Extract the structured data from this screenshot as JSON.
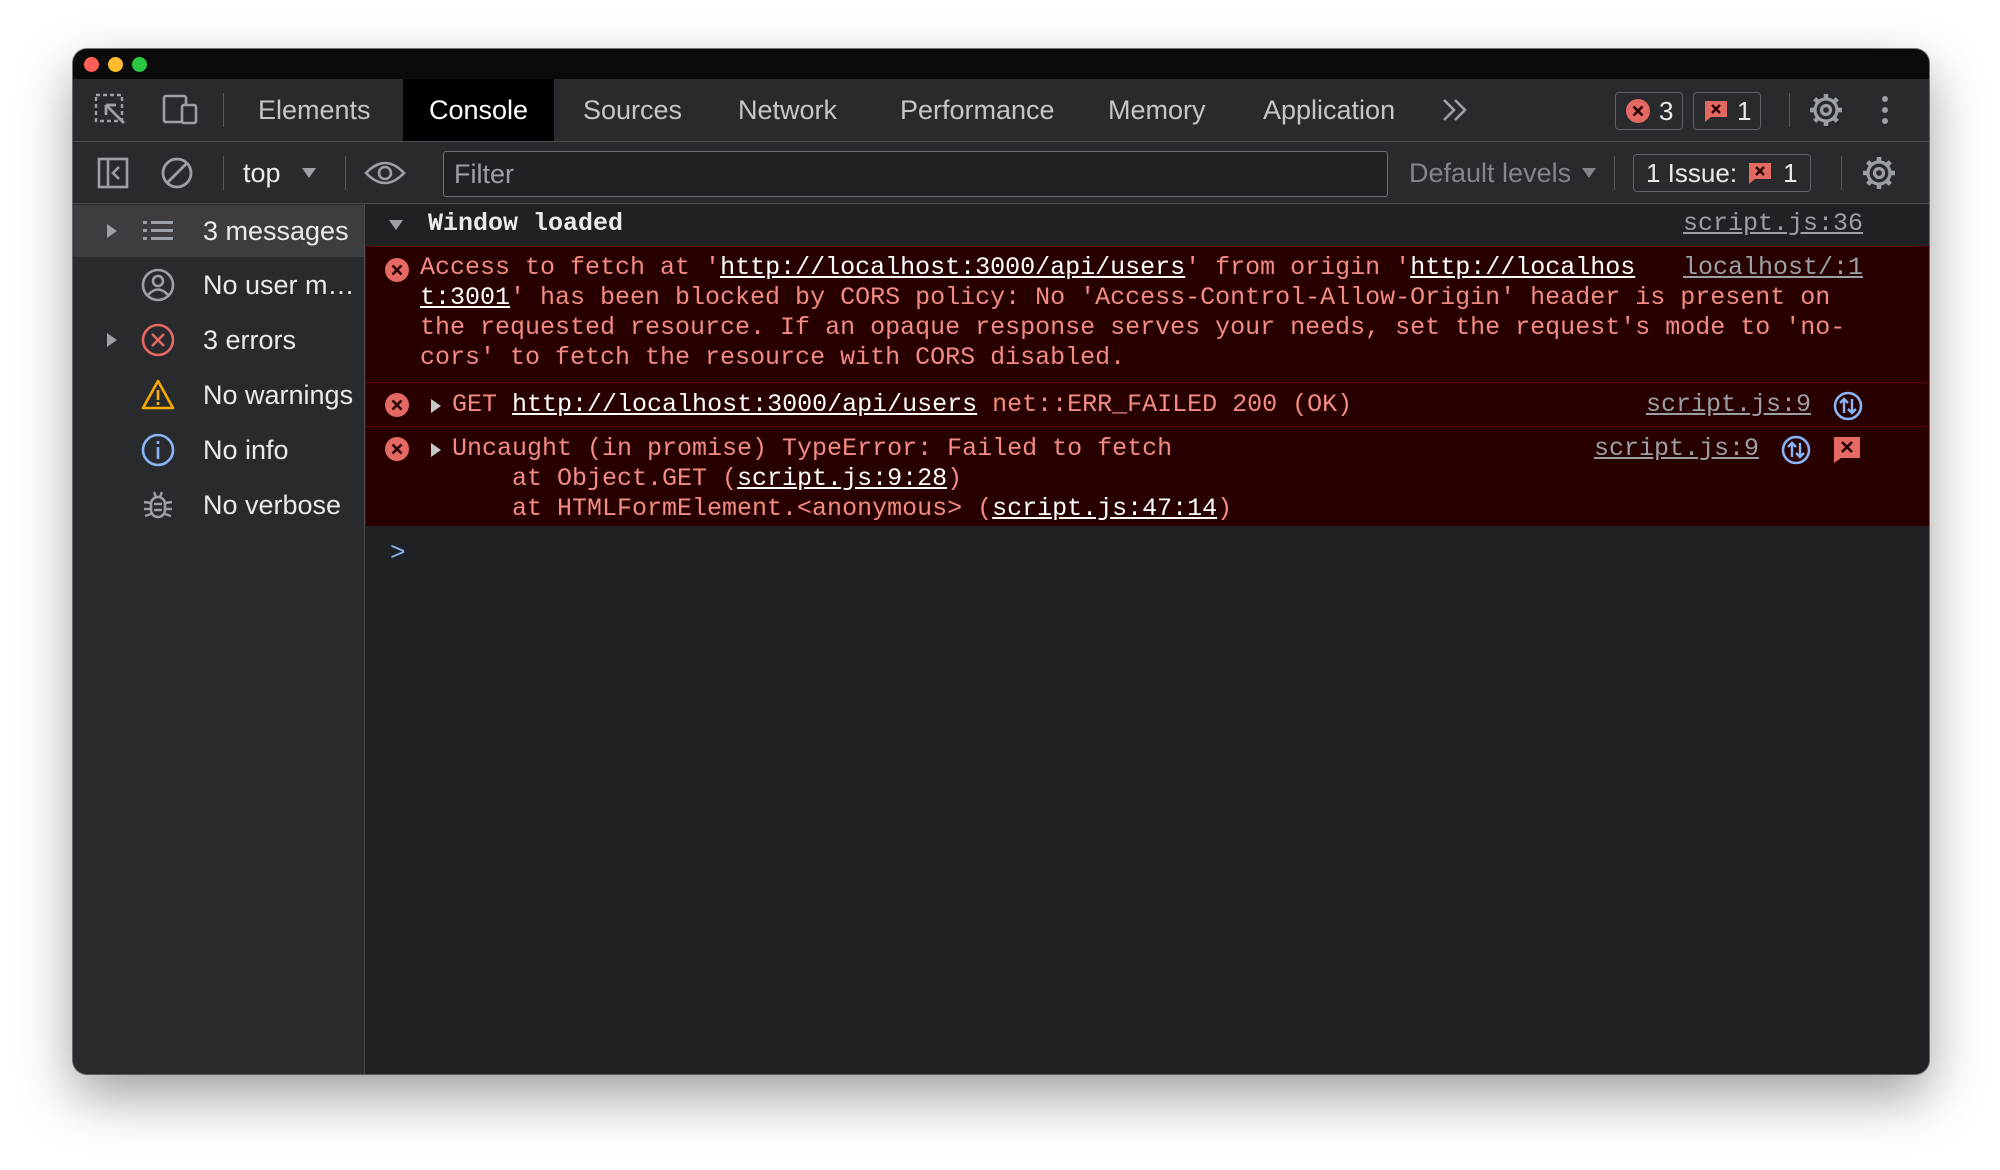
{
  "tabs": [
    "Elements",
    "Console",
    "Sources",
    "Network",
    "Performance",
    "Memory",
    "Application"
  ],
  "active_tab": "Console",
  "counters": {
    "errors": "3",
    "issues": "1"
  },
  "toolbar": {
    "context": "top",
    "filter_placeholder": "Filter",
    "levels": "Default levels",
    "issues_label": "1 Issue:",
    "issues_count": "1"
  },
  "sidebar": {
    "items": [
      {
        "label": "3 messages",
        "icon": "list-icon"
      },
      {
        "label": "No user m…",
        "icon": "user-icon"
      },
      {
        "label": "3 errors",
        "icon": "error-icon"
      },
      {
        "label": "No warnings",
        "icon": "warning-icon"
      },
      {
        "label": "No info",
        "icon": "info-icon"
      },
      {
        "label": "No verbose",
        "icon": "bug-icon"
      }
    ]
  },
  "console": {
    "group_title": "Window loaded",
    "group_source": "script.js:36",
    "cors": {
      "prefix": "Access to fetch at '",
      "url": "http://localhost:3000/api/users",
      "mid": "' from origin '",
      "origin_part1": "http://localhos",
      "origin_part2": "t:3001",
      "line2_rest": "' has been blocked by CORS policy: No 'Access-Control-Allow-Origin' header is present on",
      "line3": "the requested resource. If an opaque response serves your needs, set the request's mode to 'no-",
      "line4": "cors' to fetch the resource with CORS disabled.",
      "source": "localhost/:1"
    },
    "get": {
      "method": "GET",
      "url": "http://localhost:3000/api/users",
      "status": "net::ERR_FAILED 200 (OK)",
      "source": "script.js:9"
    },
    "uncaught": {
      "message": "Uncaught (in promise) TypeError: Failed to fetch",
      "frame1_prefix": "    at Object.GET (",
      "frame1_link": "script.js:9:28",
      "frame1_suffix": ")",
      "frame2_prefix": "    at HTMLFormElement.<anonymous> (",
      "frame2_link": "script.js:47:14",
      "frame2_suffix": ")",
      "source": "script.js:9"
    },
    "prompt": ">"
  },
  "colors": {
    "error_text": "#f28b82",
    "error_bg": "#290000",
    "accent_blue": "#8ab4f8",
    "warning": "#f9ab00",
    "panel_bg": "#292a2d"
  }
}
